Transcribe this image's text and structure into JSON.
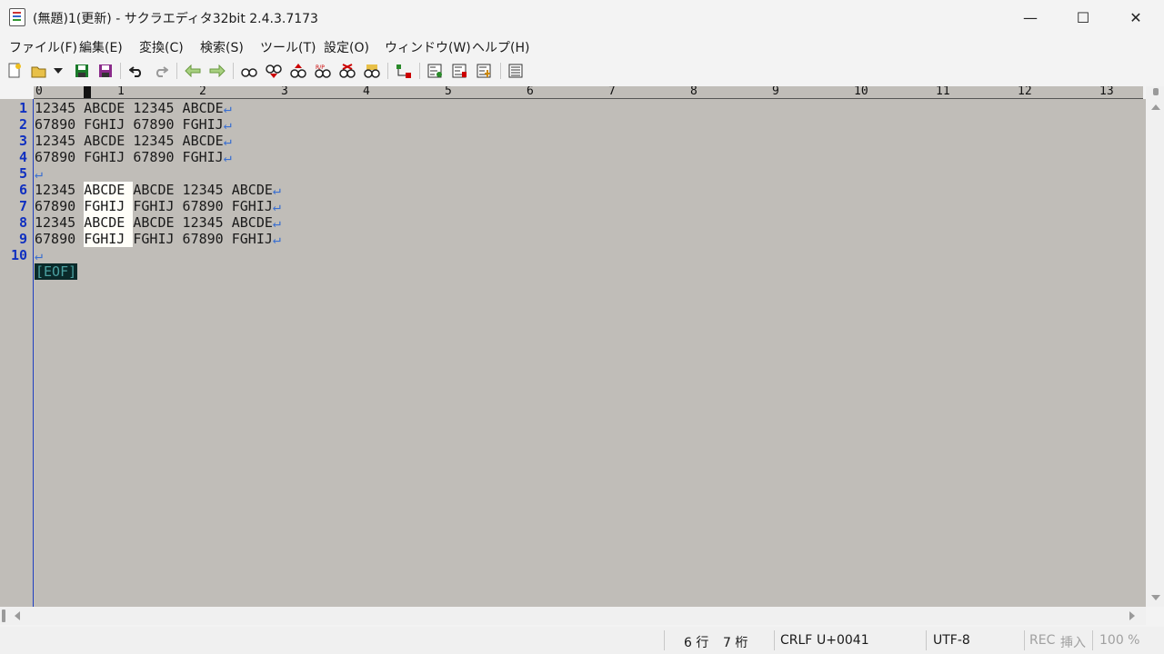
{
  "window": {
    "title": "(無題)1(更新) - サクラエディタ32bit 2.4.3.7173"
  },
  "menu": [
    "ファイル(F)",
    "編集(E)",
    "変換(C)",
    "検索(S)",
    "ツール(T)",
    "設定(O)",
    "ウィンドウ(W)",
    "ヘルプ(H)"
  ],
  "toolbar": [
    "new-file",
    "open-file",
    "open-dropdown",
    "save",
    "save-all",
    "undo",
    "redo",
    "back",
    "forward",
    "search",
    "search-prev",
    "search-next",
    "replace",
    "grep",
    "grep-replace",
    "jump",
    "outline",
    "func-list",
    "outline-tree",
    "settings"
  ],
  "ruler": {
    "labels": [
      "0",
      "1",
      "2",
      "3",
      "4",
      "5",
      "6",
      "7",
      "8",
      "9",
      "10",
      "11",
      "12",
      "13"
    ]
  },
  "editor": {
    "line_numbers": [
      "1",
      "2",
      "3",
      "4",
      "5",
      "6",
      "7",
      "8",
      "9",
      "10"
    ],
    "lines": [
      {
        "pre": "12345 ABCDE 12345 ABCDE",
        "sel": "",
        "post": ""
      },
      {
        "pre": "67890 FGHIJ 67890 FGHIJ",
        "sel": "",
        "post": ""
      },
      {
        "pre": "12345 ABCDE 12345 ABCDE",
        "sel": "",
        "post": ""
      },
      {
        "pre": "67890 FGHIJ 67890 FGHIJ",
        "sel": "",
        "post": ""
      },
      {
        "pre": "",
        "sel": "",
        "post": ""
      },
      {
        "pre": "12345 ",
        "sel": "ABCDE ",
        "post": "ABCDE 12345 ABCDE"
      },
      {
        "pre": "67890 ",
        "sel": "FGHIJ ",
        "post": "FGHIJ 67890 FGHIJ"
      },
      {
        "pre": "12345 ",
        "sel": "ABCDE ",
        "post": "ABCDE 12345 ABCDE"
      },
      {
        "pre": "67890 ",
        "sel": "FGHIJ ",
        "post": "FGHIJ 67890 FGHIJ"
      },
      {
        "pre": "",
        "sel": "",
        "post": ""
      }
    ],
    "return_mark": "↵",
    "eof": "[EOF]"
  },
  "status": {
    "row": "6 行",
    "col": "7 桁",
    "eol": "CRLF",
    "codepoint": "U+0041",
    "encoding": "UTF-8",
    "rec": "REC",
    "mode": "挿入",
    "zoom": "100 %"
  }
}
